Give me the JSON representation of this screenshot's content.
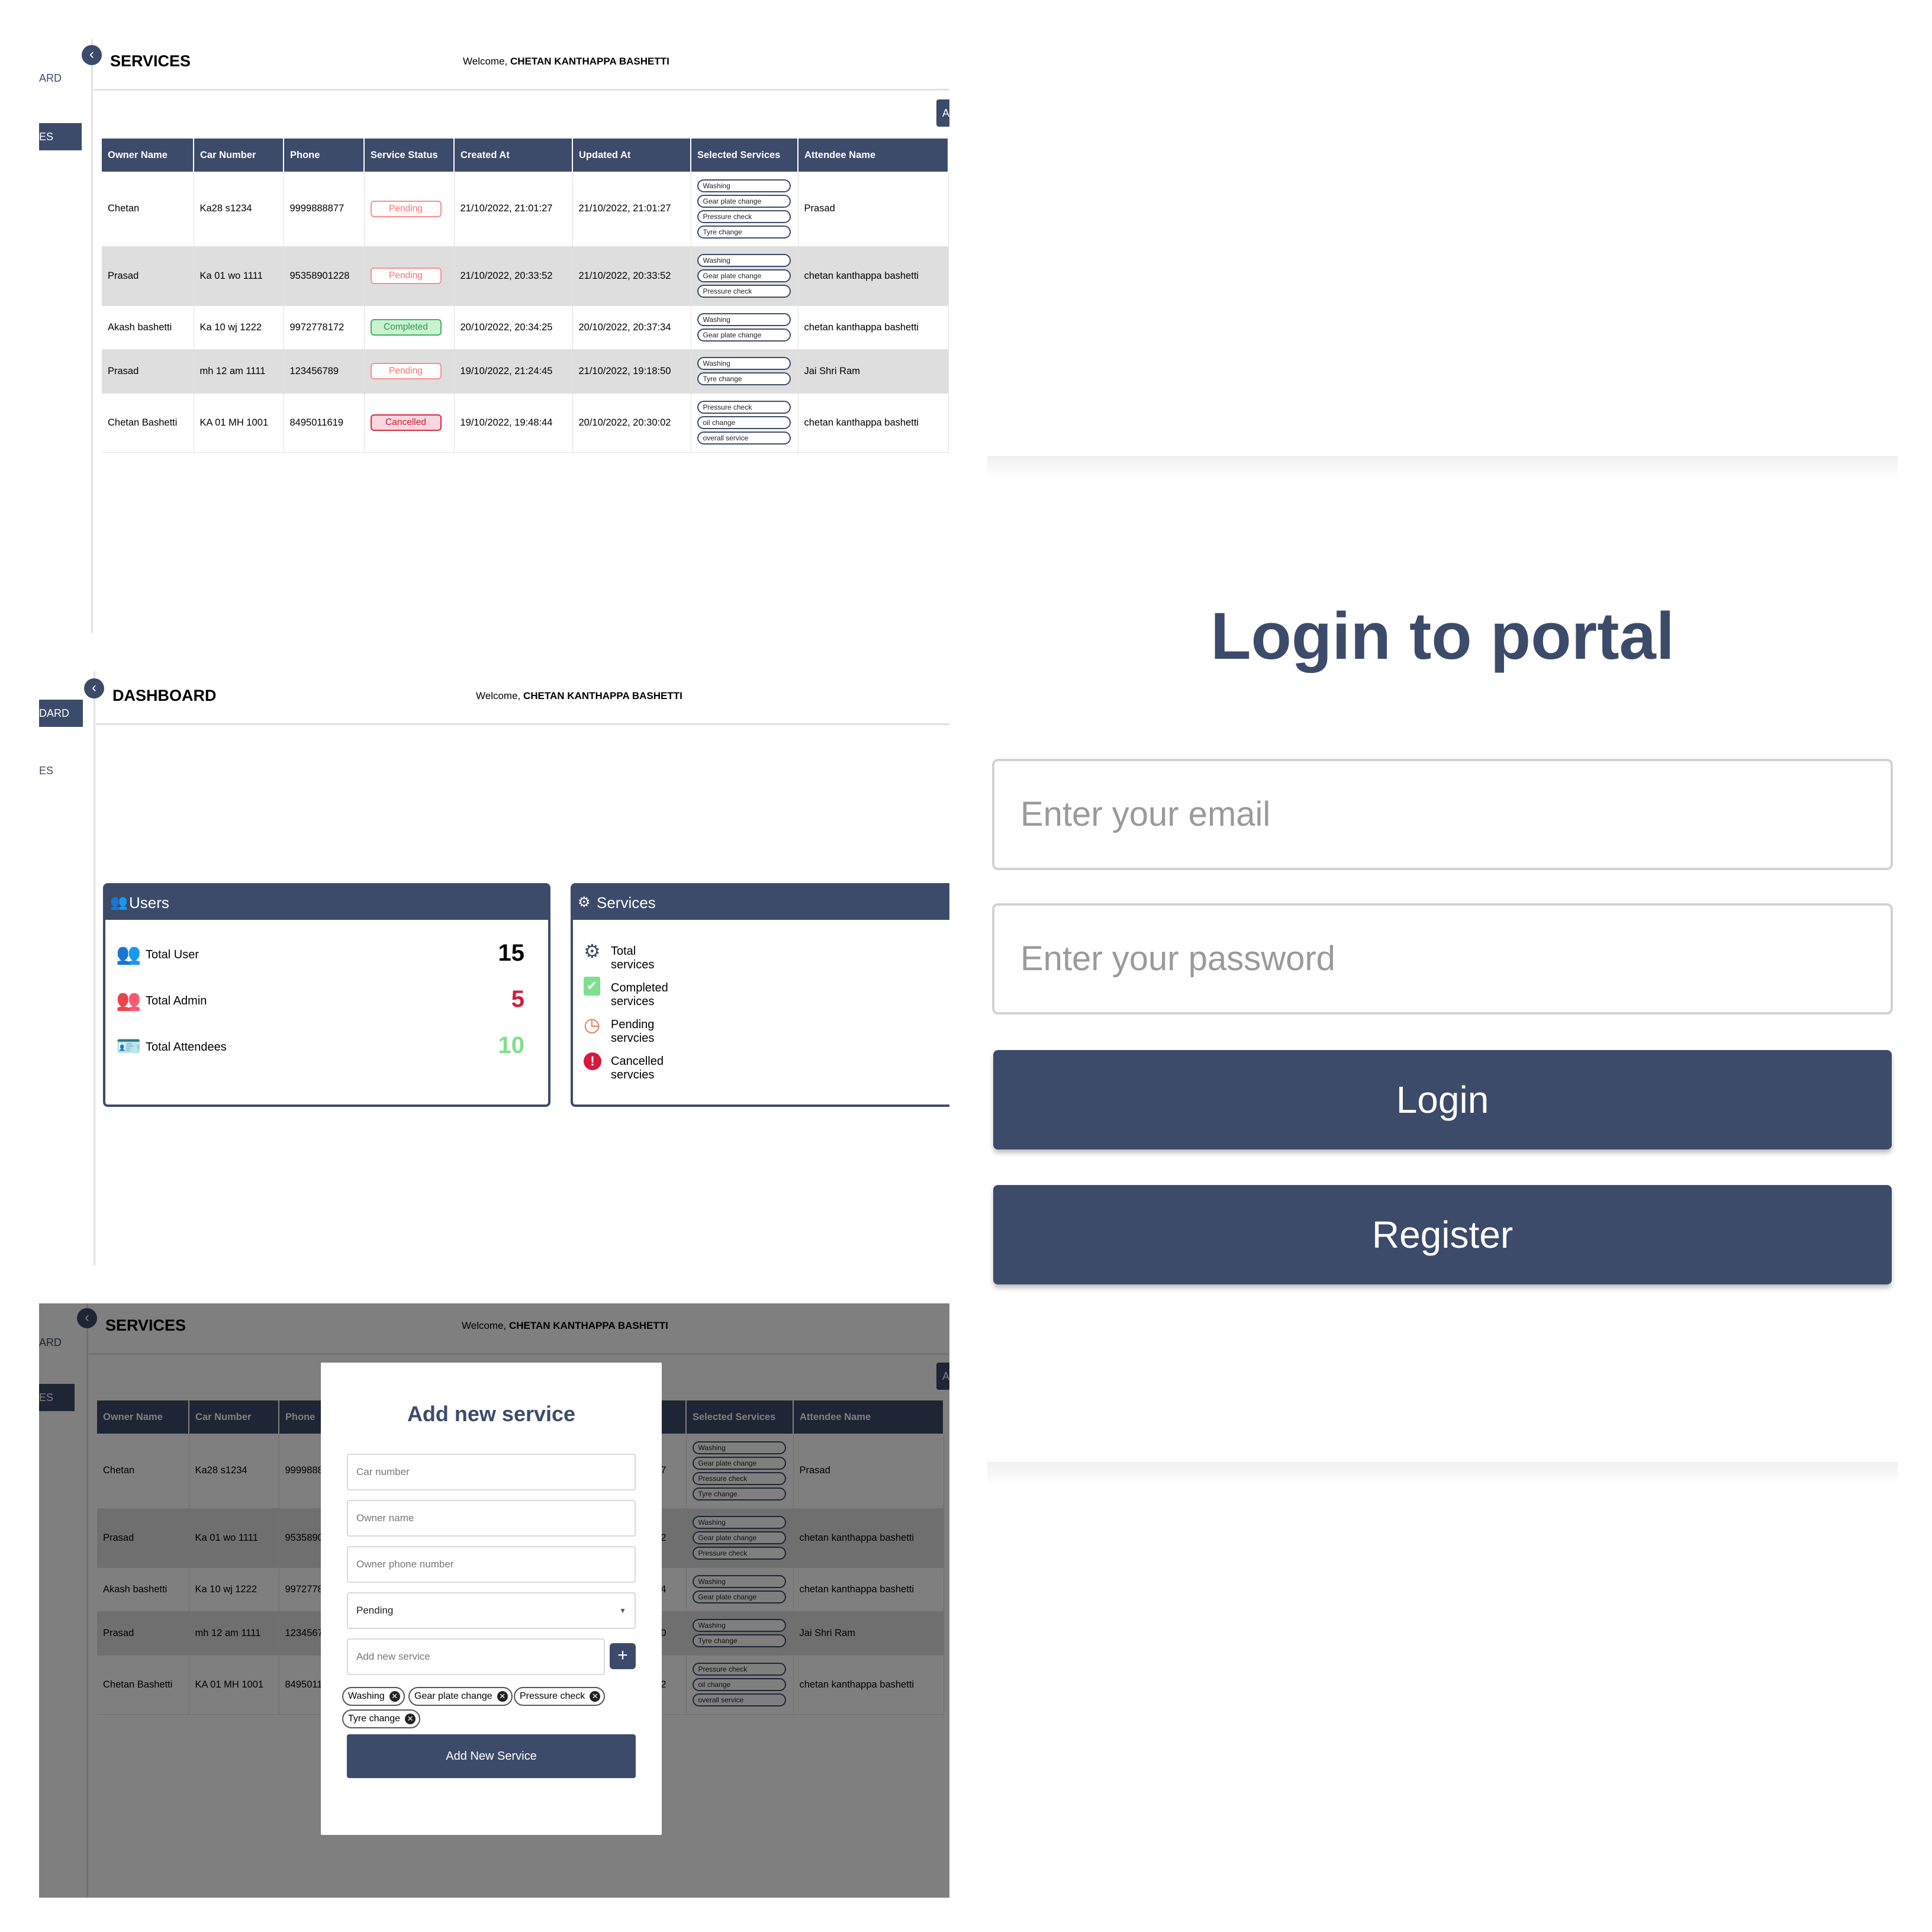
{
  "services_panel": {
    "sidebar": {
      "dashboard_label": "ARD",
      "services_label": "ES"
    },
    "collapse_icon": "‹",
    "title": "SERVICES",
    "welcome_prefix": "Welcome,",
    "welcome_name": "CHETAN KANTHAPPA BASHETTI",
    "add_button_label": "A",
    "columns": [
      "Owner Name",
      "Car Number",
      "Phone",
      "Service Status",
      "Created At",
      "Updated At",
      "Selected Services",
      "Attendee Name"
    ],
    "rows": [
      {
        "owner": "Chetan",
        "car": "Ka28 s1234",
        "phone": "9999888877",
        "status": "Pending",
        "created": "21/10/2022, 21:01:27",
        "updated": "21/10/2022, 21:01:27",
        "services": [
          "Washing",
          "Gear plate change",
          "Pressure check",
          "Tyre change"
        ],
        "attendee": "Prasad"
      },
      {
        "owner": "Prasad",
        "car": "Ka 01 wo 1111",
        "phone": "95358901228",
        "status": "Pending",
        "created": "21/10/2022, 20:33:52",
        "updated": "21/10/2022, 20:33:52",
        "services": [
          "Washing",
          "Gear plate change",
          "Pressure check"
        ],
        "attendee": "chetan kanthappa bashetti"
      },
      {
        "owner": "Akash bashetti",
        "car": "Ka 10 wj 1222",
        "phone": "9972778172",
        "status": "Completed",
        "created": "20/10/2022, 20:34:25",
        "updated": "20/10/2022, 20:37:34",
        "services": [
          "Washing",
          "Gear plate change"
        ],
        "attendee": "chetan kanthappa bashetti"
      },
      {
        "owner": "Prasad",
        "car": "mh 12 am 1111",
        "phone": "123456789",
        "status": "Pending",
        "created": "19/10/2022, 21:24:45",
        "updated": "21/10/2022, 19:18:50",
        "services": [
          "Washing",
          "Tyre change"
        ],
        "attendee": "Jai Shri Ram"
      },
      {
        "owner": "Chetan Bashetti",
        "car": "KA 01 MH 1001",
        "phone": "8495011619",
        "status": "Cancelled",
        "created": "19/10/2022, 19:48:44",
        "updated": "20/10/2022, 20:30:02",
        "services": [
          "Pressure check",
          "oil change",
          "overall service"
        ],
        "attendee": "chetan kanthappa bashetti"
      }
    ]
  },
  "dashboard_panel": {
    "sidebar": {
      "dashboard_label": "DARD",
      "services_label": "ES"
    },
    "title": "DASHBOARD",
    "welcome_prefix": "Welcome,",
    "welcome_name": "CHETAN KANTHAPPA BASHETTI",
    "users_card": {
      "title": "Users",
      "items": [
        {
          "label": "Total User",
          "value": "15",
          "color": "#000000",
          "icon": "group-icon"
        },
        {
          "label": "Total Admin",
          "value": "5",
          "color": "#d8193c",
          "icon": "admin-group-icon"
        },
        {
          "label": "Total Attendees",
          "value": "10",
          "color": "#7ee08f",
          "icon": "badge-icon"
        }
      ]
    },
    "services_card": {
      "title": "Services",
      "items": [
        {
          "label": "Total services",
          "icon": "gear-icon"
        },
        {
          "label": "Completed services",
          "icon": "clipboard-check-icon"
        },
        {
          "label": "Pending servcies",
          "icon": "clock-icon"
        },
        {
          "label": "Cancelled servcies",
          "icon": "alert-icon"
        }
      ]
    }
  },
  "modal_panel": {
    "title": "Add new service",
    "car_placeholder": "Car number",
    "owner_placeholder": "Owner name",
    "phone_placeholder": "Owner phone number",
    "status_value": "Pending",
    "new_service_placeholder": "Add new service",
    "plus_label": "+",
    "chips": [
      "Washing",
      "Gear plate change",
      "Pressure check",
      "Tyre change"
    ],
    "submit_label": "Add New Service"
  },
  "login_panel": {
    "title": "Login to portal",
    "email_placeholder": "Enter your email",
    "password_placeholder": "Enter your password",
    "login_label": "Login",
    "register_label": "Register"
  },
  "colors": {
    "primary": "#3c4b69",
    "pending": "#ff7070",
    "completed": "#2d9a49",
    "cancelled": "#c21c38"
  }
}
